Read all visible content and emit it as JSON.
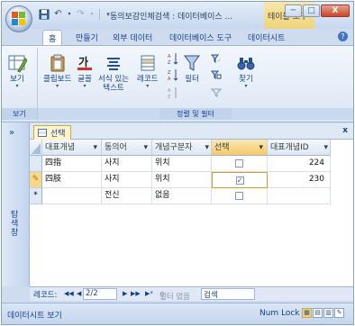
{
  "titlebar": {
    "title": "동의보감인체검색 : 데이터베이스 ...",
    "context_tab": "테이블 도구",
    "minimize": "─",
    "maximize": "□",
    "close": "X"
  },
  "tabs": [
    "홈",
    "만들기",
    "외부 데이터",
    "데이터베이스 도구",
    "데이터시트"
  ],
  "ribbon": {
    "view_label": "보기",
    "group_view": "보기",
    "clipboard_label": "클립보드",
    "font_label": "글꼴",
    "rich_text_label": "서식 있는\n텍스트",
    "records_label": "레코드",
    "filter_label": "필터",
    "find_label": "찾기",
    "group_sort_filter": "정렬 및 필터"
  },
  "nav": {
    "chevron": "»",
    "label": "탐색 창"
  },
  "document": {
    "tab_label": "선택",
    "close": "x"
  },
  "table": {
    "columns": [
      "대표개념",
      "동의어",
      "개념구분자",
      "선택",
      "대표개념ID"
    ],
    "rows": [
      {
        "selector": "",
        "c0": "四指",
        "c1": "사지",
        "c2": "위치",
        "checked": false,
        "c4": "224"
      },
      {
        "selector": "✎",
        "c0": "四肢",
        "c1": "사지",
        "c2": "위치",
        "checked": true,
        "c4": "230"
      },
      {
        "selector": "*",
        "c0": "",
        "c1": "전신",
        "c2": "없음",
        "checked": false,
        "c4": ""
      }
    ]
  },
  "recnav": {
    "label": "레코드:",
    "first": "◀◀",
    "prev": "◀",
    "position": "2/2",
    "next": "▶",
    "last": "▶▶",
    "new": "▶*",
    "filter": "필터 없음",
    "search": "검색"
  },
  "status": {
    "left": "데이터시트 보기",
    "numlock": "Num Lock"
  }
}
